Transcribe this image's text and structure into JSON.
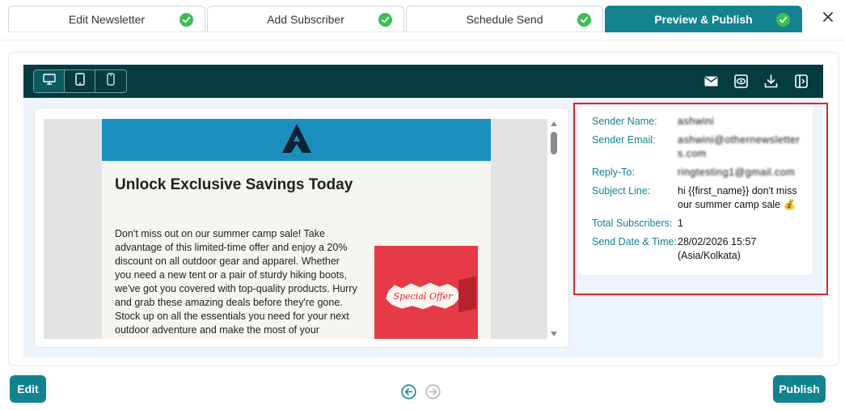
{
  "steps": [
    {
      "label": "Edit Newsletter",
      "completed": true
    },
    {
      "label": "Add Subscriber",
      "completed": true
    },
    {
      "label": "Schedule Send",
      "completed": true
    },
    {
      "label": "Preview & Publish",
      "completed": true,
      "active": true
    }
  ],
  "colors": {
    "accent": "#12838f",
    "toolbar": "#043c40",
    "highlight": "#e0242d",
    "check": "#3bbf54"
  },
  "toolbar": {
    "devices": [
      "desktop-icon",
      "tablet-icon",
      "mobile-icon"
    ],
    "tools": [
      "mail-icon",
      "eye-icon",
      "download-icon",
      "panel-toggle-icon"
    ]
  },
  "email": {
    "title": "Unlock Exclusive Savings Today",
    "body": "Don't miss out on our summer camp sale! Take advantage of this limited-time offer and enjoy a 20% discount on all outdoor gear and apparel. Whether you need a new tent or a pair of sturdy hiking boots, we've got you covered with top-quality products. Hurry and grab these amazing deals before they're gone. Stock up on all the essentials you need for your next outdoor adventure and make the most of your",
    "promo_text": "Special Offer"
  },
  "details": {
    "sender_name_label": "Sender Name:",
    "sender_name": "ashwini",
    "sender_email_label": "Sender Email:",
    "sender_email": "ashwini@othernewsletters.com",
    "reply_to_label": "Reply-To:",
    "reply_to": "ringtesting1@gmail.com",
    "subject_label": "Subject Line:",
    "subject": "hi {{first_name}} don't miss our summer camp sale 💰",
    "total_label": "Total Subscribers:",
    "total": "1",
    "send_date_label": "Send Date & Time:",
    "send_date": "28/02/2026 15:57",
    "send_tz": "(Asia/Kolkata)"
  },
  "actions": {
    "edit_label": "Edit",
    "publish_label": "Publish"
  }
}
